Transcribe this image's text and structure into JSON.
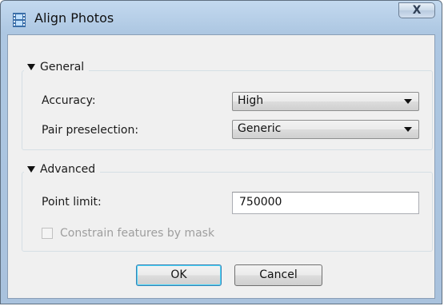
{
  "window": {
    "title": "Align Photos",
    "close_glyph": "X"
  },
  "general": {
    "section_label": "General",
    "accuracy_label": "Accuracy:",
    "accuracy_value": "High",
    "pair_label": "Pair preselection:",
    "pair_value": "Generic"
  },
  "advanced": {
    "section_label": "Advanced",
    "point_limit_label": "Point limit:",
    "point_limit_value": "750000",
    "constrain_label": "Constrain features by mask",
    "constrain_checked": false,
    "constrain_enabled": false
  },
  "buttons": {
    "ok": "OK",
    "cancel": "Cancel"
  },
  "icons": {
    "title": "film-strip-icon",
    "close": "close-icon",
    "collapse": "triangle-down-icon",
    "dropdown": "chevron-down-icon"
  }
}
